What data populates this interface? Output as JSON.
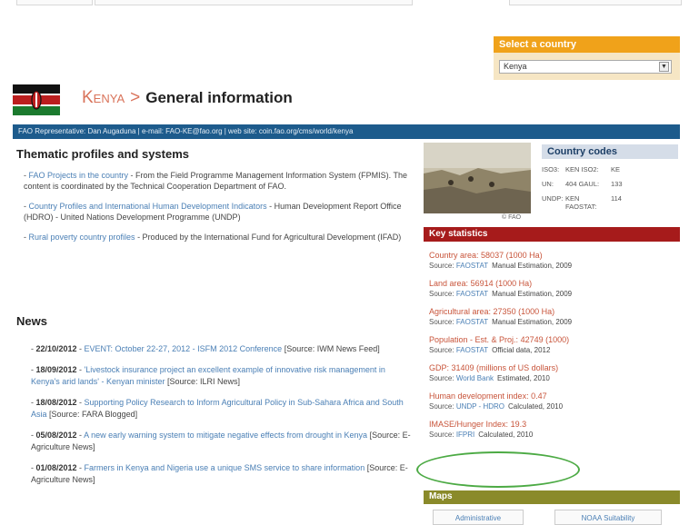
{
  "selector": {
    "header": "Select a country",
    "selected": "Kenya"
  },
  "title": {
    "country": "Kenya",
    "separator": ">",
    "section": "General information"
  },
  "rep_bar": "FAO Representative: Dan Augaduna | e-mail: FAO-KE@fao.org | web site: coin.fao.org/cms/world/kenya",
  "thematic": {
    "heading": "Thematic profiles and systems",
    "items": [
      {
        "link": "FAO Projects in the country",
        "text": " - From the Field Programme Management Information System (FPMIS). The content is coordinated by the Technical Cooperation Department of FAO."
      },
      {
        "link": "Country Profiles and International Human Development Indicators",
        "text": " - Human Development Report Office (HDRO) - United Nations Development Programme (UNDP)"
      },
      {
        "link": "Rural poverty country profiles",
        "text": " - Produced by the International Fund for Agricultural Development (IFAD)"
      }
    ]
  },
  "news": {
    "heading": "News",
    "items": [
      {
        "date": "22/10/2012",
        "link": "EVENT: October 22-27, 2012 - ISFM 2012 Conference",
        "source": "[Source: IWM News Feed]"
      },
      {
        "date": "18/09/2012",
        "link": "'Livestock insurance project an excellent example of innovative risk management in Kenya's arid lands' - Kenyan minister",
        "source": "[Source: ILRI News]"
      },
      {
        "date": "18/08/2012",
        "link": "Supporting Policy Research to Inform Agricultural Policy in Sub-Sahara Africa and South Asia",
        "source": "[Source: FARA Blogged]"
      },
      {
        "date": "05/08/2012",
        "link": "A new early warning system to mitigate negative effects from drought in Kenya",
        "source": "[Source: E-Agriculture News]"
      },
      {
        "date": "01/08/2012",
        "link": "Farmers in Kenya and Nigeria use a unique SMS service to share information",
        "source": "[Source: E-Agriculture News]"
      }
    ]
  },
  "photo_credit": "© FAO",
  "country_codes": {
    "heading": "Country codes",
    "rows": [
      [
        "ISO3:",
        "KEN ISO2:",
        "KE",
        ""
      ],
      [
        "UN:",
        "404 GAUL:",
        "133",
        ""
      ],
      [
        "UNDP:",
        "KEN FAOSTAT:",
        "114",
        ""
      ]
    ]
  },
  "key_stats": {
    "heading": "Key statistics",
    "items": [
      {
        "label": "Country area",
        "value": "58037 (1000 Ha)",
        "source_label": "Source:",
        "source": "FAOSTAT",
        "note": "Manual Estimation, 2009"
      },
      {
        "label": "Land area",
        "value": "56914 (1000 Ha)",
        "source_label": "Source:",
        "source": "FAOSTAT",
        "note": "Manual Estimation, 2009"
      },
      {
        "label": "Agricultural area",
        "value": "27350 (1000 Ha)",
        "source_label": "Source:",
        "source": "FAOSTAT",
        "note": "Manual Estimation, 2009"
      },
      {
        "label": "Population - Est. & Proj.",
        "value": "42749 (1000)",
        "source_label": "Source:",
        "source": "FAOSTAT",
        "note": "Official data, 2012"
      },
      {
        "label": "GDP",
        "value": "31409 (millions of US dollars)",
        "source_label": "Source:",
        "source": "World Bank",
        "note": "Estimated, 2010"
      },
      {
        "label": "Human development index",
        "value": "0.47",
        "source_label": "Source:",
        "source": "UNDP - HDRO",
        "note": "Calculated, 2010"
      },
      {
        "label": "IMASE/Hunger Index",
        "value": "19.3",
        "source_label": "Source:",
        "source": "IFPRI",
        "note": "Calculated, 2010"
      }
    ]
  },
  "maps": {
    "heading": "Maps",
    "buttons": [
      "Administrative",
      "NOAA Suitability"
    ]
  },
  "colors": {
    "rep_bar": "#1d5b8c",
    "key_stats": "#a61b1b",
    "select_header": "#f0a21a",
    "maps": "#8a8a2a",
    "highlight": "#4caa44"
  }
}
